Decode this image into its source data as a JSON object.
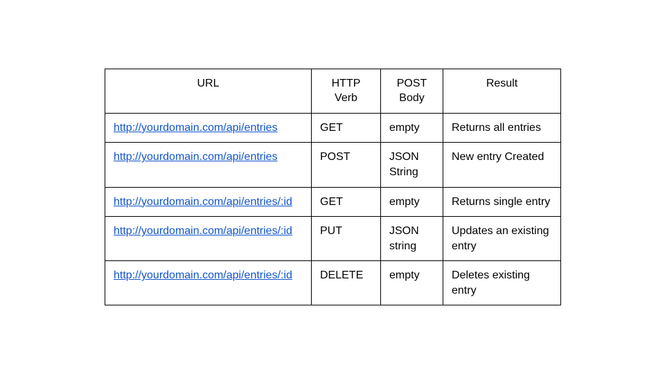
{
  "headers": {
    "url": "URL",
    "verb": "HTTP Verb",
    "body": "POST Body",
    "result": "Result"
  },
  "rows": [
    {
      "url": "http://yourdomain.com/api/entries",
      "verb": "GET",
      "body": "empty",
      "result": "Returns all entries"
    },
    {
      "url": "http://yourdomain.com/api/entries",
      "verb": "POST",
      "body": "JSON String",
      "result": "New entry Created"
    },
    {
      "url": "http://yourdomain.com/api/entries/:id",
      "verb": "GET",
      "body": "empty",
      "result": "Returns single entry"
    },
    {
      "url": "http://yourdomain.com/api/entries/:id",
      "verb": "PUT",
      "body": "JSON string",
      "result": "Updates an existing entry"
    },
    {
      "url": "http://yourdomain.com/api/entries/:id",
      "verb": "DELETE",
      "body": "empty",
      "result": "Deletes existing entry"
    }
  ]
}
